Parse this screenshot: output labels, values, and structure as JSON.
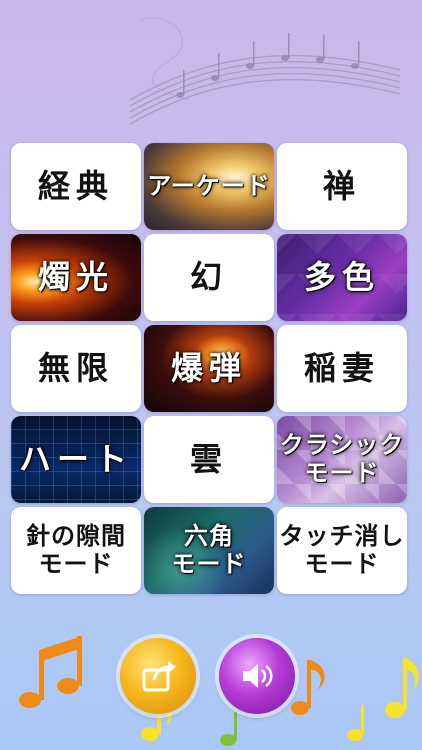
{
  "tiles": [
    {
      "label": "経典",
      "style": "plain",
      "size": "big",
      "name": "tile-keiten"
    },
    {
      "label": "アーケード",
      "style": "arcade",
      "size": "mid",
      "name": "tile-arcade"
    },
    {
      "label": "禅",
      "style": "plain",
      "size": "big",
      "name": "tile-zen"
    },
    {
      "label": "燭光",
      "style": "candle",
      "size": "big",
      "name": "tile-candlelight"
    },
    {
      "label": "幻",
      "style": "plain",
      "size": "big",
      "name": "tile-maboroshi"
    },
    {
      "label": "多色",
      "style": "multi",
      "size": "big",
      "name": "tile-multicolor"
    },
    {
      "label": "無限",
      "style": "plain",
      "size": "big",
      "name": "tile-infinite"
    },
    {
      "label": "爆弾",
      "style": "explode",
      "size": "big",
      "name": "tile-bomb"
    },
    {
      "label": "稲妻",
      "style": "plain",
      "size": "big",
      "name": "tile-lightning"
    },
    {
      "label": "ハート",
      "style": "heart",
      "size": "big",
      "name": "tile-heart"
    },
    {
      "label": "雲",
      "style": "plain",
      "size": "big",
      "name": "tile-cloud"
    },
    {
      "label": "クラシック\nモード",
      "style": "classic",
      "size": "two",
      "name": "tile-classic-mode"
    },
    {
      "label": "針の隙間\nモード",
      "style": "plain",
      "size": "two",
      "name": "tile-needle-gap-mode"
    },
    {
      "label": "六角\nモード",
      "style": "hex",
      "size": "two",
      "name": "tile-hexagon-mode"
    },
    {
      "label": "タッチ消し\nモード",
      "style": "plain",
      "size": "two",
      "name": "tile-touch-erase-mode"
    }
  ],
  "buttons": {
    "share_icon": "share-icon",
    "sound_icon": "speaker-icon"
  },
  "colors": {
    "tile_bg": "#ffffff",
    "text_dark": "#121212",
    "share_button": "#f6b81e",
    "sound_button": "#b43ad6",
    "note_orange": "#f08a16",
    "note_yellow": "#f5e22a"
  }
}
